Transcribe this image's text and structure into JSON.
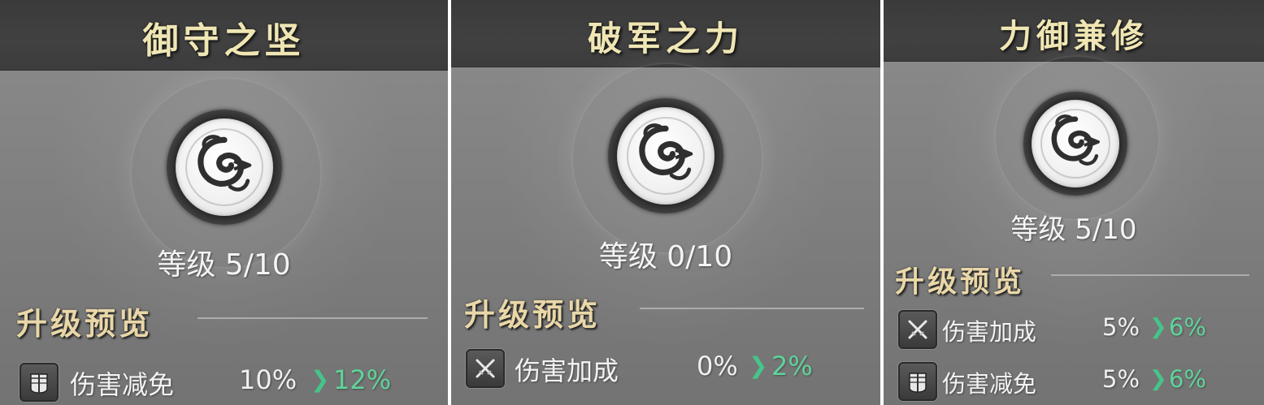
{
  "panels": [
    {
      "title": "御守之坚",
      "level_label": "等级 5/10",
      "section_title": "升级预览",
      "stats": [
        {
          "icon": "armor-icon",
          "name": "伤害减免",
          "from": "10%",
          "to": "12%"
        }
      ]
    },
    {
      "title": "破军之力",
      "level_label": "等级 0/10",
      "section_title": "升级预览",
      "stats": [
        {
          "icon": "crossed-swords-icon",
          "name": "伤害加成",
          "from": "0%",
          "to": "2%"
        }
      ]
    },
    {
      "title": "力御兼修",
      "level_label": "等级 5/10",
      "section_title": "升级预览",
      "stats": [
        {
          "icon": "crossed-swords-icon",
          "name": "伤害加成",
          "from": "5%",
          "to": "6%"
        },
        {
          "icon": "armor-icon",
          "name": "伤害减免",
          "from": "5%",
          "to": "6%"
        }
      ]
    }
  ],
  "arrow_glyph": "❯",
  "colors": {
    "title": "#efe6b4",
    "section_title": "#e9d7a8",
    "increase_value": "#5fd39a",
    "arrow": "#46c48a",
    "panel_bg": "#838383",
    "title_bar_bg": "#3c3c3c"
  },
  "emblem_icon": "swirl-emblem-icon"
}
